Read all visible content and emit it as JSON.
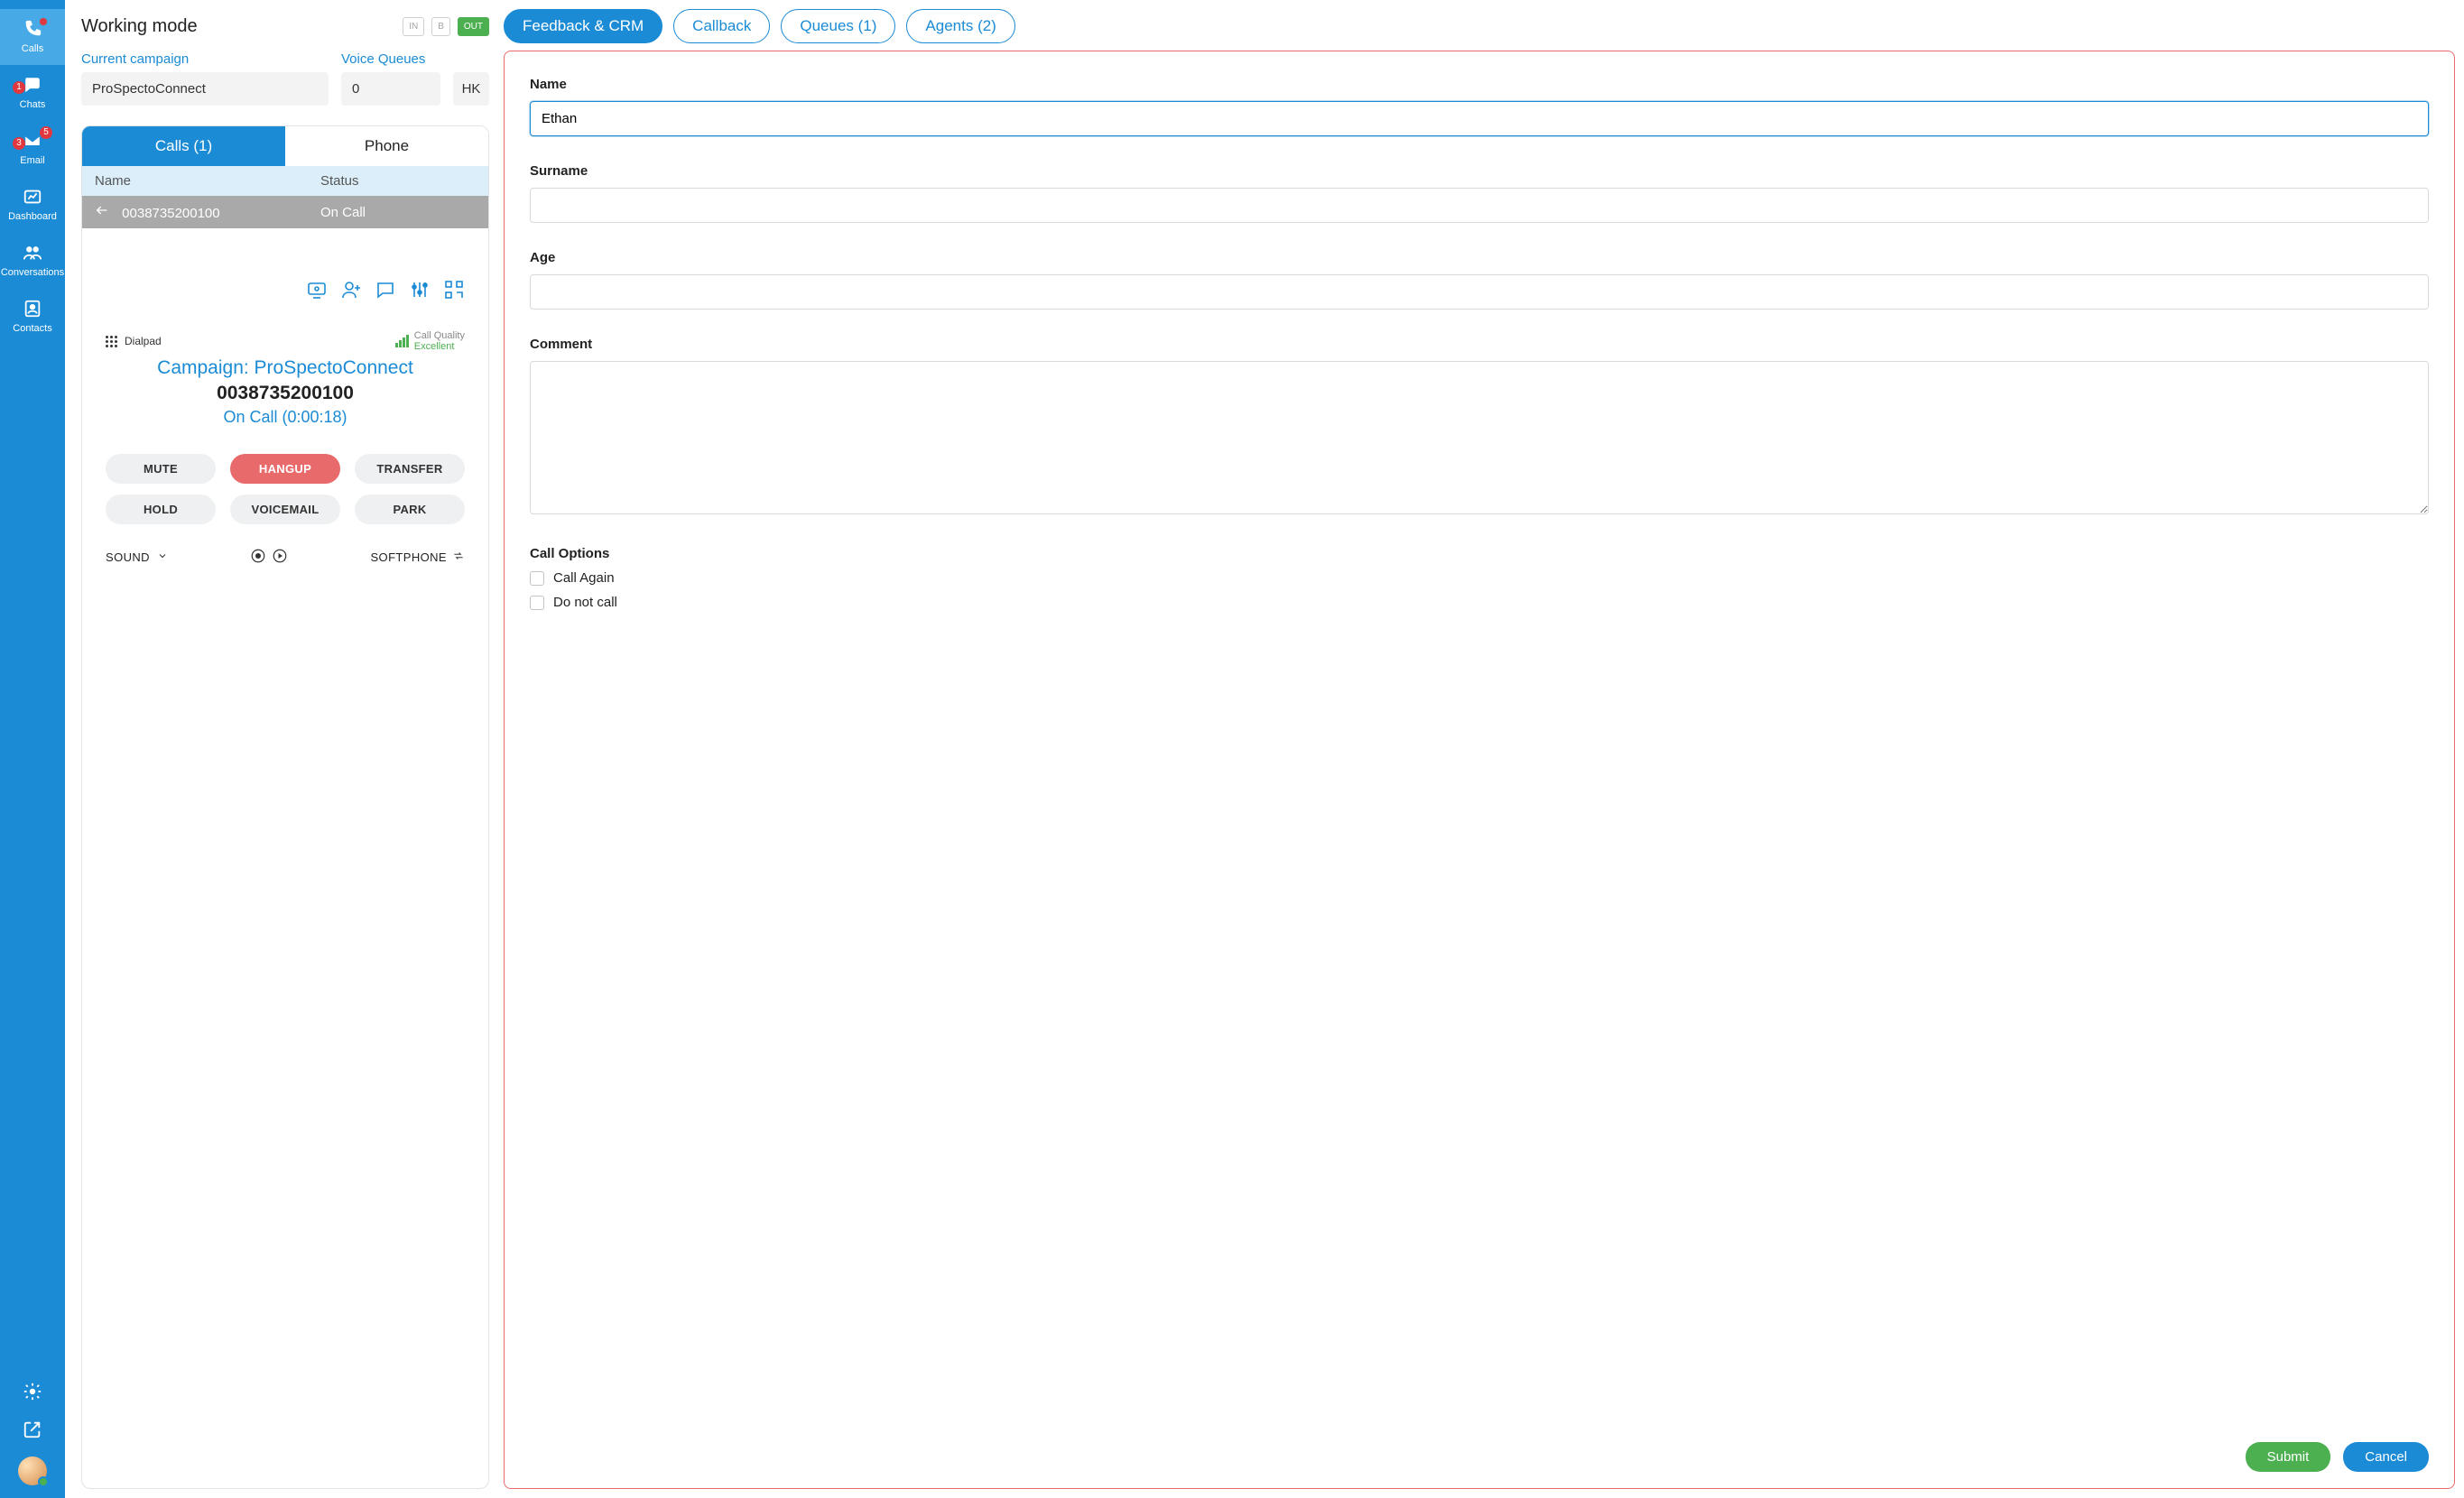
{
  "sidebar": {
    "items": [
      {
        "label": "Calls",
        "active": true
      },
      {
        "label": "Chats",
        "badge": "1"
      },
      {
        "label": "Email",
        "badge_primary": "5",
        "badge_secondary": "3"
      },
      {
        "label": "Dashboard"
      },
      {
        "label": "Conversations"
      },
      {
        "label": "Contacts"
      }
    ]
  },
  "working_mode": {
    "title": "Working mode",
    "buttons": {
      "in": "IN",
      "b": "B",
      "out": "OUT"
    },
    "campaign_label": "Current campaign",
    "campaign_value": "ProSpectoConnect",
    "voice_queues_label": "Voice Queues",
    "voice_queues_value": "0",
    "suffix": "HK"
  },
  "call_panel": {
    "tabs": {
      "calls": "Calls (1)",
      "phone": "Phone"
    },
    "table": {
      "headers": {
        "name": "Name",
        "status": "Status"
      },
      "rows": [
        {
          "name": "0038735200100",
          "status": "On Call"
        }
      ]
    },
    "dialpad_label": "Dialpad",
    "call_quality_label": "Call Quality",
    "call_quality_value": "Excellent",
    "campaign_line": "Campaign: ProSpectoConnect",
    "number": "0038735200100",
    "status_line": "On Call (0:00:18)",
    "actions": {
      "mute": "MUTE",
      "hangup": "HANGUP",
      "transfer": "TRANSFER",
      "hold": "HOLD",
      "voicemail": "VOICEMAIL",
      "park": "PARK"
    },
    "sound_label": "SOUND",
    "softphone_label": "SOFTPHONE"
  },
  "right_tabs": [
    {
      "label": "Feedback & CRM",
      "active": true
    },
    {
      "label": "Callback"
    },
    {
      "label": "Queues (1)"
    },
    {
      "label": "Agents (2)"
    }
  ],
  "form": {
    "name_label": "Name",
    "name_value": "Ethan",
    "surname_label": "Surname",
    "surname_value": "",
    "age_label": "Age",
    "age_value": "",
    "comment_label": "Comment",
    "comment_value": "",
    "call_options_label": "Call Options",
    "opt_call_again": "Call Again",
    "opt_do_not_call": "Do not call",
    "submit": "Submit",
    "cancel": "Cancel"
  }
}
